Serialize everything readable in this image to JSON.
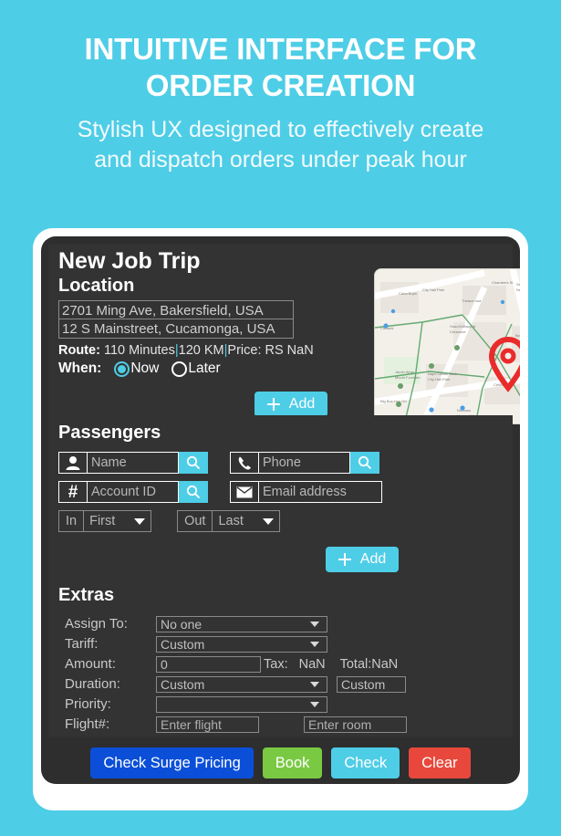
{
  "header": {
    "headline": "INTUITIVE INTERFACE FOR ORDER CREATION",
    "subhead": "Stylish UX designed to effectively create and dispatch orders under peak hour"
  },
  "card": {
    "title": "New Job Trip"
  },
  "location": {
    "section_title": "Location",
    "pickup_value": "2701 Ming Ave, Bakersfield, USA",
    "dropoff_value": "12 S Mainstreet, Cucamonga, USA",
    "route_label": "Route:",
    "route_duration": "110 Minutes",
    "route_distance": "120 KM",
    "route_price": "Price: RS NaN",
    "separator": "|",
    "when_label": "When:",
    "when_now": "Now",
    "when_later": "Later",
    "when_selected": "Now",
    "add_label": "Add",
    "map_icon": "map-pin-icon"
  },
  "passengers": {
    "section_title": "Passengers",
    "name_placeholder": "Name",
    "name_icon": "person-icon",
    "account_placeholder": "Account ID",
    "account_icon": "hash-icon",
    "phone_placeholder": "Phone",
    "phone_icon": "phone-icon",
    "email_placeholder": "Email address",
    "email_icon": "envelope-icon",
    "search_icon": "search-icon",
    "in_label": "In",
    "in_value": "First",
    "out_label": "Out",
    "out_value": "Last",
    "add_label": "Add"
  },
  "extras": {
    "section_title": "Extras",
    "assign_label": "Assign To:",
    "assign_value": "No one",
    "tariff_label": "Tariff:",
    "tariff_value": "Custom",
    "amount_label": "Amount:",
    "amount_value": "0",
    "tax_label": "Tax:",
    "tax_value": "NaN",
    "total_label": "Total:NaN",
    "duration_label": "Duration:",
    "duration_value": "Custom",
    "duration_custom_value": "Custom",
    "priority_label": "Priority:",
    "priority_value": "",
    "flight_label": "Flight#:",
    "flight_placeholder": "Enter flight",
    "room_placeholder": "Enter room"
  },
  "actions": {
    "surge_label": "Check Surge Pricing",
    "book_label": "Book",
    "check_label": "Check",
    "clear_label": "Clear"
  },
  "colors": {
    "background": "#4ecde6",
    "card": "#2e2e2e",
    "panel": "#333333",
    "accent": "#4ecde6",
    "surge": "#0b4fd8",
    "book": "#7ac943",
    "check": "#4ecde6",
    "clear": "#e8483c",
    "pin": "#ea2b2b"
  }
}
